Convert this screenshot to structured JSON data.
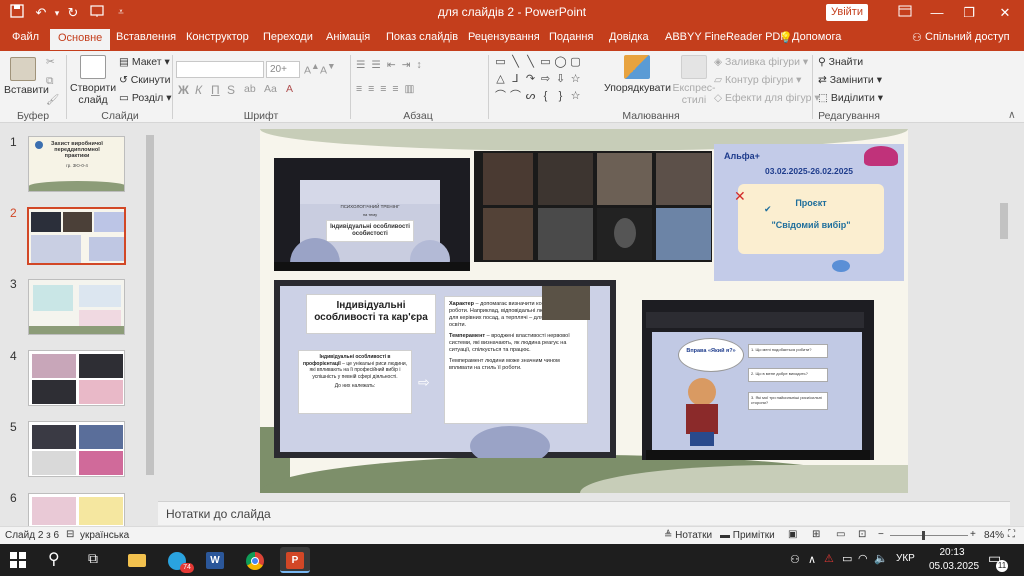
{
  "window": {
    "title": "для слайдів 2  -  PowerPoint",
    "signin_label": "Увійти"
  },
  "tabs": [
    "Файл",
    "Основне",
    "Вставлення",
    "Конструктор",
    "Переходи",
    "Анімація",
    "Показ слайдів",
    "Рецензування",
    "Подання",
    "Довідка",
    "ABBYY FineReader PDF",
    "Допомога",
    "Спільний доступ"
  ],
  "ribbon": {
    "paste": "Вставити",
    "new_slide_1": "Створити",
    "new_slide_2": "слайд",
    "layout": "Макет",
    "reset": "Скинути",
    "section": "Розділ",
    "font_size": "20+",
    "font_buttons": [
      "Ж",
      "К",
      "П",
      "S"
    ],
    "arrange": "Упорядкувати",
    "quick_styles_1": "Експрес-",
    "quick_styles_2": "стилі",
    "shape_fill": "Заливка фігури",
    "shape_outline": "Контур фігури",
    "shape_effects": "Ефекти для фігур",
    "find": "Знайти",
    "replace": "Замінити",
    "select": "Виділити",
    "groups": {
      "clipboard": "Буфер обміну",
      "slides": "Слайди",
      "font": "Шрифт",
      "paragraph": "Абзац",
      "drawing": "Малювання",
      "editing": "Редагування"
    }
  },
  "thumbnails": {
    "numbers": [
      "1",
      "2",
      "3",
      "4",
      "5",
      "6"
    ],
    "slide1_title": "Захист виробничої переддипломної практики",
    "slide1_sub": "гр. 3Ю-0-4"
  },
  "slide": {
    "shot1": {
      "title_small": "ПСИХОЛОГІЧНИЙ ТРЕНІНГ",
      "on_topic": "на тему",
      "topic": "Індивідуальні особливості особистості"
    },
    "shot3": {
      "brand": "Альфа+",
      "dates": "03.02.2025-26.02.2025",
      "project": "Проєкт",
      "project_name": "\"Свідомий вибір\""
    },
    "shot4": {
      "heading": "Індивідуальні особливості та кар'єра",
      "box_title": "Індивідуальні особливості в профорієнтації",
      "box_text": " – це унікальні риси людини, які впливають на її професійний вибір і успішність у певній сфері діяльності.",
      "box_footer": "До них належать:",
      "char_title": "Характер",
      "char_text": " – допомагає визначити комфортні умови роботи. Наприклад, відповідальні люди підходять для керівних посад, а терплячі – для медицини та освіти.",
      "temp_title": "Темперамент",
      "temp_text": " – вроджені властивості нервової системи, які визначають, як людина реагує на ситуації, спілкується та працює.",
      "temp_note": "Темперамент людини може значним чином впливати на стиль її роботи."
    },
    "shot5": {
      "bubble": "Вправа «Який я?»",
      "q1": "1. Що мені подобається робити?",
      "q2": "2. Що в мене добре виходить?",
      "q3": "3. Які мої три найсильніші риси/сильні сторони?"
    }
  },
  "notes_placeholder": "Нотатки до слайда",
  "status": {
    "slide_counter": "Слайд 2 з 6",
    "language": "українська",
    "notes_btn": "Нотатки",
    "comments_btn": "Примітки",
    "zoom": "84%"
  },
  "taskbar": {
    "lang": "УКР",
    "time": "20:13",
    "date": "05.03.2025",
    "telegram_badge": "74",
    "notif_count": "11"
  },
  "colors": {
    "accent": "#c43e1c",
    "selected_thumb_border": "#d24726",
    "slide_bg": "#f7f5ec",
    "sage": "#7d8f6a"
  }
}
